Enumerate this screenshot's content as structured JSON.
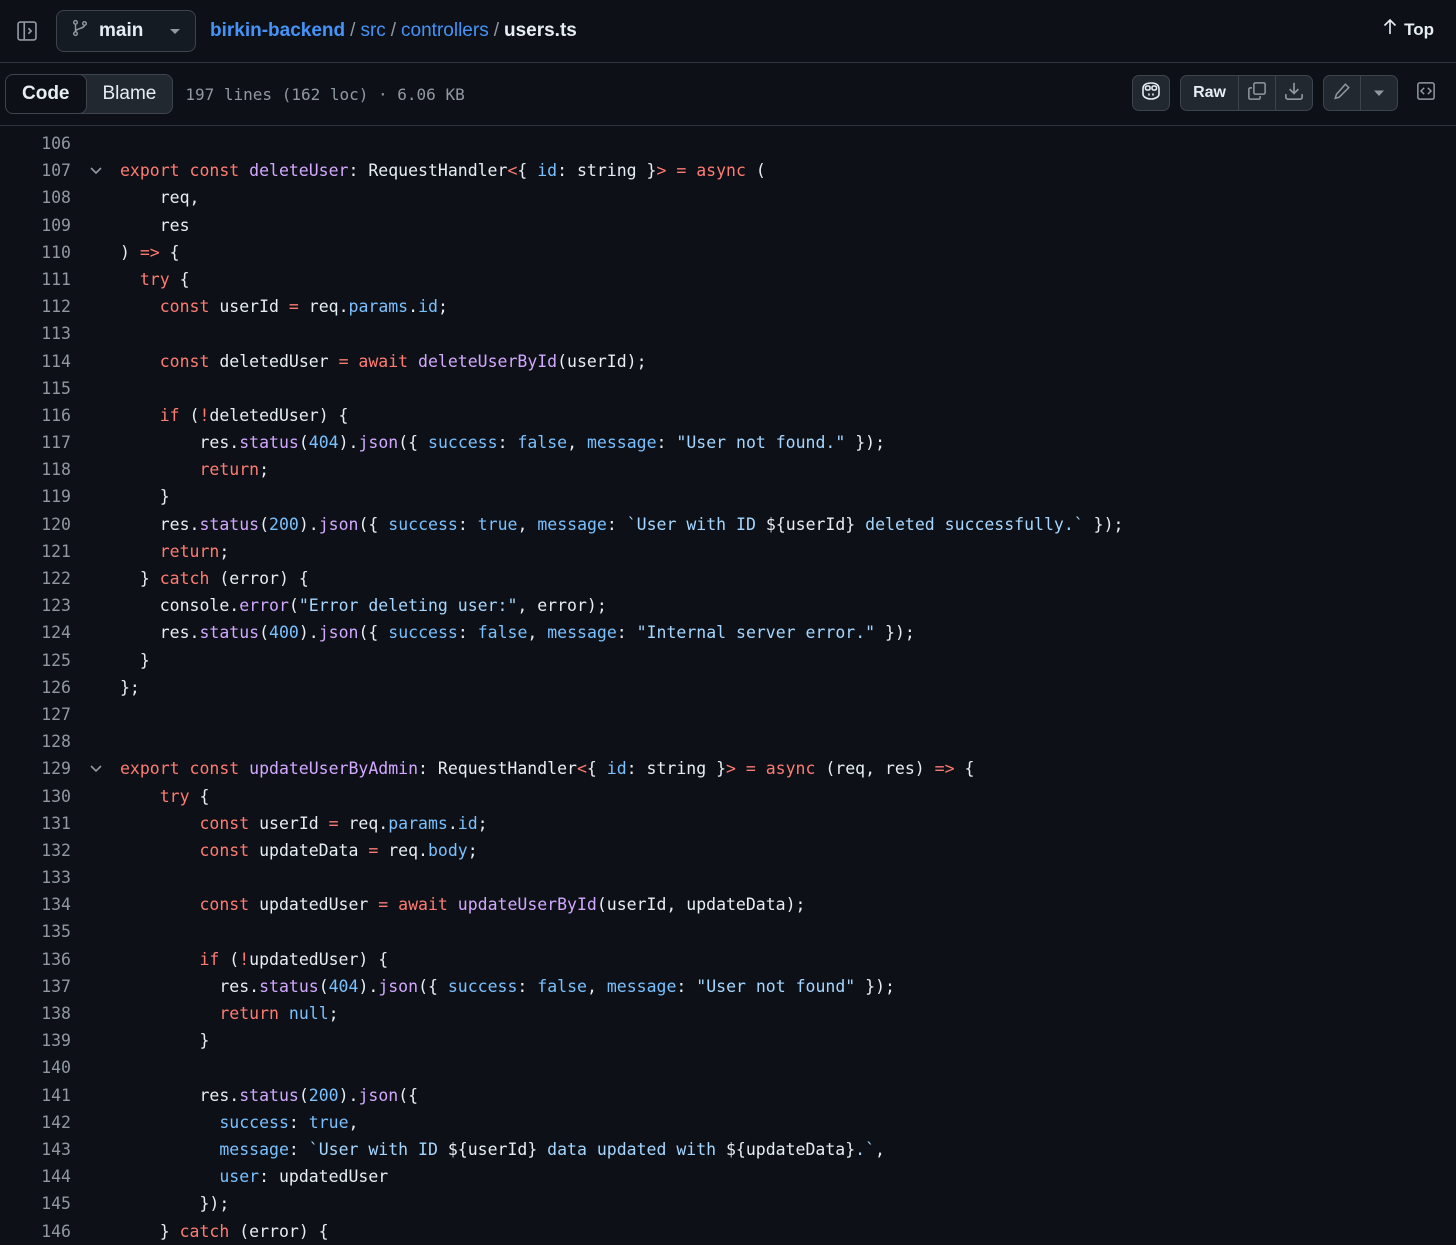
{
  "header": {
    "branch": "main",
    "repo": "birkin-backend",
    "path": [
      "src",
      "controllers"
    ],
    "file": "users.ts",
    "top_label": "Top"
  },
  "toolbar": {
    "tab_code": "Code",
    "tab_blame": "Blame",
    "file_info": "197 lines (162 loc) · 6.06 KB",
    "raw_label": "Raw"
  },
  "icons": {
    "sidebar": "sidebar-toggle-icon",
    "branch": "git-branch-icon",
    "top": "arrow-up-icon",
    "copilot": "copilot-icon",
    "copy": "copy-icon",
    "download": "download-icon",
    "edit": "pencil-icon",
    "more": "triangle-down-icon",
    "symbols": "code-symbols-icon"
  },
  "colors": {
    "background": "#0d1117",
    "keyword": "#ff7b72",
    "function": "#d2a8ff",
    "constant": "#79c0ff",
    "string": "#a5d6ff",
    "link": "#4493f8"
  },
  "code_lines": [
    {
      "n": "106",
      "fold": false,
      "t": []
    },
    {
      "n": "107",
      "fold": true,
      "t": [
        [
          "k",
          "export const "
        ],
        [
          "f",
          "deleteUser"
        ],
        [
          "",
          ": RequestHandler"
        ],
        [
          "k",
          "<"
        ],
        [
          "",
          "{ "
        ],
        [
          "c",
          "id"
        ],
        [
          "",
          ": string }"
        ],
        [
          "k",
          "> = async "
        ],
        [
          "",
          "("
        ]
      ]
    },
    {
      "n": "108",
      "fold": false,
      "t": [
        [
          "",
          "    req,"
        ]
      ]
    },
    {
      "n": "109",
      "fold": false,
      "t": [
        [
          "",
          "    res"
        ]
      ]
    },
    {
      "n": "110",
      "fold": false,
      "t": [
        [
          "",
          ") "
        ],
        [
          "k",
          "=>"
        ],
        [
          "",
          " {"
        ]
      ]
    },
    {
      "n": "111",
      "fold": false,
      "t": [
        [
          "k",
          "  try"
        ],
        [
          "",
          " {"
        ]
      ]
    },
    {
      "n": "112",
      "fold": false,
      "t": [
        [
          "k",
          "    const "
        ],
        [
          "",
          "userId "
        ],
        [
          "k",
          "= "
        ],
        [
          "",
          "req."
        ],
        [
          "c",
          "params"
        ],
        [
          "",
          "."
        ],
        [
          "c",
          "id"
        ],
        [
          "",
          ";"
        ]
      ]
    },
    {
      "n": "113",
      "fold": false,
      "t": []
    },
    {
      "n": "114",
      "fold": false,
      "t": [
        [
          "k",
          "    const "
        ],
        [
          "",
          "deletedUser "
        ],
        [
          "k",
          "= await "
        ],
        [
          "f",
          "deleteUserById"
        ],
        [
          "",
          "(userId);"
        ]
      ]
    },
    {
      "n": "115",
      "fold": false,
      "t": []
    },
    {
      "n": "116",
      "fold": false,
      "t": [
        [
          "k",
          "    if "
        ],
        [
          "",
          "("
        ],
        [
          "k",
          "!"
        ],
        [
          "",
          "deletedUser) {"
        ]
      ]
    },
    {
      "n": "117",
      "fold": false,
      "t": [
        [
          "",
          "        res."
        ],
        [
          "f",
          "status"
        ],
        [
          "",
          "("
        ],
        [
          "c",
          "404"
        ],
        [
          "",
          ")."
        ],
        [
          "f",
          "json"
        ],
        [
          "",
          "({ "
        ],
        [
          "c",
          "success"
        ],
        [
          "",
          ": "
        ],
        [
          "c",
          "false"
        ],
        [
          "",
          ", "
        ],
        [
          "c",
          "message"
        ],
        [
          "",
          ": "
        ],
        [
          "s",
          "\"User not found.\""
        ],
        [
          "",
          " });"
        ]
      ]
    },
    {
      "n": "118",
      "fold": false,
      "t": [
        [
          "k",
          "        return"
        ],
        [
          "",
          ";"
        ]
      ]
    },
    {
      "n": "119",
      "fold": false,
      "t": [
        [
          "",
          "    }"
        ]
      ]
    },
    {
      "n": "120",
      "fold": false,
      "t": [
        [
          "",
          "    res."
        ],
        [
          "f",
          "status"
        ],
        [
          "",
          "("
        ],
        [
          "c",
          "200"
        ],
        [
          "",
          ")."
        ],
        [
          "f",
          "json"
        ],
        [
          "",
          "({ "
        ],
        [
          "c",
          "success"
        ],
        [
          "",
          ": "
        ],
        [
          "c",
          "true"
        ],
        [
          "",
          ", "
        ],
        [
          "c",
          "message"
        ],
        [
          "",
          ": "
        ],
        [
          "s",
          "`User with ID "
        ],
        [
          "",
          "${userId}"
        ],
        [
          "s",
          " deleted successfully.`"
        ],
        [
          "",
          " });"
        ]
      ]
    },
    {
      "n": "121",
      "fold": false,
      "t": [
        [
          "k",
          "    return"
        ],
        [
          "",
          ";"
        ]
      ]
    },
    {
      "n": "122",
      "fold": false,
      "t": [
        [
          "",
          "  } "
        ],
        [
          "k",
          "catch"
        ],
        [
          "",
          " (error) {"
        ]
      ]
    },
    {
      "n": "123",
      "fold": false,
      "t": [
        [
          "",
          "    console."
        ],
        [
          "f",
          "error"
        ],
        [
          "",
          "("
        ],
        [
          "s",
          "\"Error deleting user:\""
        ],
        [
          "",
          ", error);"
        ]
      ]
    },
    {
      "n": "124",
      "fold": false,
      "t": [
        [
          "",
          "    res."
        ],
        [
          "f",
          "status"
        ],
        [
          "",
          "("
        ],
        [
          "c",
          "400"
        ],
        [
          "",
          ")."
        ],
        [
          "f",
          "json"
        ],
        [
          "",
          "({ "
        ],
        [
          "c",
          "success"
        ],
        [
          "",
          ": "
        ],
        [
          "c",
          "false"
        ],
        [
          "",
          ", "
        ],
        [
          "c",
          "message"
        ],
        [
          "",
          ": "
        ],
        [
          "s",
          "\"Internal server error.\""
        ],
        [
          "",
          " });"
        ]
      ]
    },
    {
      "n": "125",
      "fold": false,
      "t": [
        [
          "",
          "  }"
        ]
      ]
    },
    {
      "n": "126",
      "fold": false,
      "t": [
        [
          "",
          "};"
        ]
      ]
    },
    {
      "n": "127",
      "fold": false,
      "t": []
    },
    {
      "n": "128",
      "fold": false,
      "t": []
    },
    {
      "n": "129",
      "fold": true,
      "t": [
        [
          "k",
          "export const "
        ],
        [
          "f",
          "updateUserByAdmin"
        ],
        [
          "",
          ": RequestHandler"
        ],
        [
          "k",
          "<"
        ],
        [
          "",
          "{ "
        ],
        [
          "c",
          "id"
        ],
        [
          "",
          ": string }"
        ],
        [
          "k",
          "> = async "
        ],
        [
          "",
          "(req, res) "
        ],
        [
          "k",
          "=>"
        ],
        [
          "",
          " {"
        ]
      ]
    },
    {
      "n": "130",
      "fold": false,
      "t": [
        [
          "k",
          "    try"
        ],
        [
          "",
          " {"
        ]
      ]
    },
    {
      "n": "131",
      "fold": false,
      "t": [
        [
          "k",
          "        const "
        ],
        [
          "",
          "userId "
        ],
        [
          "k",
          "= "
        ],
        [
          "",
          "req."
        ],
        [
          "c",
          "params"
        ],
        [
          "",
          "."
        ],
        [
          "c",
          "id"
        ],
        [
          "",
          ";"
        ]
      ]
    },
    {
      "n": "132",
      "fold": false,
      "t": [
        [
          "k",
          "        const "
        ],
        [
          "",
          "updateData "
        ],
        [
          "k",
          "= "
        ],
        [
          "",
          "req."
        ],
        [
          "c",
          "body"
        ],
        [
          "",
          ";"
        ]
      ]
    },
    {
      "n": "133",
      "fold": false,
      "t": []
    },
    {
      "n": "134",
      "fold": false,
      "t": [
        [
          "k",
          "        const "
        ],
        [
          "",
          "updatedUser "
        ],
        [
          "k",
          "= await "
        ],
        [
          "f",
          "updateUserById"
        ],
        [
          "",
          "(userId, updateData);"
        ]
      ]
    },
    {
      "n": "135",
      "fold": false,
      "t": []
    },
    {
      "n": "136",
      "fold": false,
      "t": [
        [
          "k",
          "        if "
        ],
        [
          "",
          "("
        ],
        [
          "k",
          "!"
        ],
        [
          "",
          "updatedUser) {"
        ]
      ]
    },
    {
      "n": "137",
      "fold": false,
      "t": [
        [
          "",
          "          res."
        ],
        [
          "f",
          "status"
        ],
        [
          "",
          "("
        ],
        [
          "c",
          "404"
        ],
        [
          "",
          ")."
        ],
        [
          "f",
          "json"
        ],
        [
          "",
          "({ "
        ],
        [
          "c",
          "success"
        ],
        [
          "",
          ": "
        ],
        [
          "c",
          "false"
        ],
        [
          "",
          ", "
        ],
        [
          "c",
          "message"
        ],
        [
          "",
          ": "
        ],
        [
          "s",
          "\"User not found\""
        ],
        [
          "",
          " });"
        ]
      ]
    },
    {
      "n": "138",
      "fold": false,
      "t": [
        [
          "k",
          "          return "
        ],
        [
          "c",
          "null"
        ],
        [
          "",
          ";"
        ]
      ]
    },
    {
      "n": "139",
      "fold": false,
      "t": [
        [
          "",
          "        }"
        ]
      ]
    },
    {
      "n": "140",
      "fold": false,
      "t": []
    },
    {
      "n": "141",
      "fold": false,
      "t": [
        [
          "",
          "        res."
        ],
        [
          "f",
          "status"
        ],
        [
          "",
          "("
        ],
        [
          "c",
          "200"
        ],
        [
          "",
          ")."
        ],
        [
          "f",
          "json"
        ],
        [
          "",
          "({"
        ]
      ]
    },
    {
      "n": "142",
      "fold": false,
      "t": [
        [
          "c",
          "          success"
        ],
        [
          "",
          ": "
        ],
        [
          "c",
          "true"
        ],
        [
          "",
          ","
        ]
      ]
    },
    {
      "n": "143",
      "fold": false,
      "t": [
        [
          "c",
          "          message"
        ],
        [
          "",
          ": "
        ],
        [
          "s",
          "`User with ID "
        ],
        [
          "",
          "${userId}"
        ],
        [
          "s",
          " data updated with "
        ],
        [
          "",
          "${updateData}"
        ],
        [
          "s",
          ".`"
        ],
        [
          "",
          ","
        ]
      ]
    },
    {
      "n": "144",
      "fold": false,
      "t": [
        [
          "c",
          "          user"
        ],
        [
          "",
          ": updatedUser"
        ]
      ]
    },
    {
      "n": "145",
      "fold": false,
      "t": [
        [
          "",
          "        });"
        ]
      ]
    },
    {
      "n": "146",
      "fold": false,
      "t": [
        [
          "",
          "    } "
        ],
        [
          "k",
          "catch"
        ],
        [
          "",
          " (error) {"
        ]
      ]
    }
  ]
}
